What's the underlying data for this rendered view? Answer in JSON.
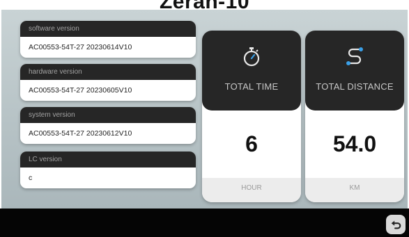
{
  "screen": {
    "title": "Zeran-10"
  },
  "versions": [
    {
      "label": "software version",
      "value": "AC00553-54T-27 20230614V10"
    },
    {
      "label": "hardware version",
      "value": "AC00553-54T-27 20230605V10"
    },
    {
      "label": "system version",
      "value": "AC00553-54T-27 20230612V10"
    },
    {
      "label": "LC version",
      "value": "c"
    }
  ],
  "stats": {
    "time": {
      "label": "TOTAL TIME",
      "value": "6",
      "unit": "HOUR",
      "icon": "stopwatch-icon"
    },
    "distance": {
      "label": "TOTAL DISTANCE",
      "value": "54.0",
      "unit": "KM",
      "icon": "route-icon"
    }
  },
  "footer": {
    "back_icon": "back-arrow-icon"
  },
  "colors": {
    "card_header": "#262626",
    "accent_icon": "#3aa0e8",
    "panel": "#bcc7ca",
    "bottom_bar": "#050505"
  }
}
